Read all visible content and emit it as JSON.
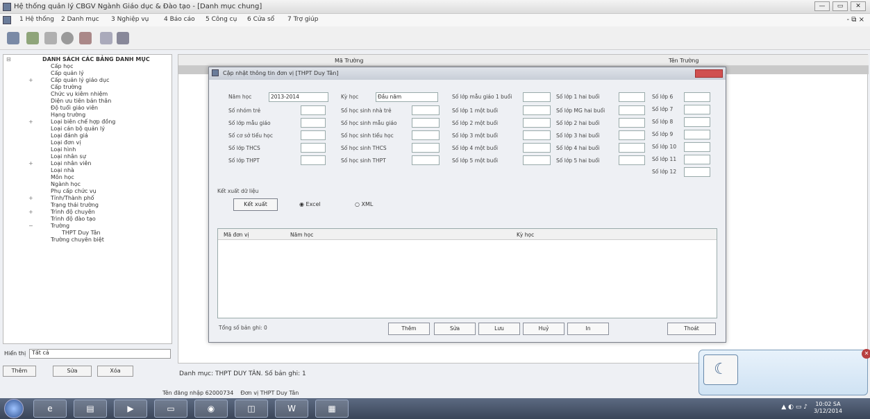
{
  "window": {
    "title": "Hệ thống quản lý CBGV Ngành Giáo dục & Đào tạo - [Danh mục chung]",
    "buttons": [
      "—",
      "▭",
      "✕"
    ]
  },
  "menu": {
    "items": [
      "1 Hệ thống",
      "2 Danh mục",
      "3 Nghiệp vụ",
      "4 Báo cáo",
      "5 Công cụ",
      "6 Cửa sổ",
      "7 Trợ giúp"
    ],
    "mdi_controls": "- ⧉ ×"
  },
  "tree": {
    "root": "DANH SÁCH CÁC BẢNG DANH MỤC",
    "items": [
      "Cấp học",
      "Cấp quản lý",
      "Cấp quản lý giáo dục",
      "Cấp trường",
      "Chức vụ kiêm nhiệm",
      "Diện ưu tiên bản thân",
      "Độ tuổi giáo viên",
      "Hạng trường",
      "Loại biên chế hợp đồng",
      "Loại cán bộ quản lý",
      "Loại đánh giá",
      "Loại đơn vị",
      "Loại hình",
      "Loại nhân sự",
      "Loại nhân viên",
      "Loại nhà",
      "Môn học",
      "Ngành học",
      "Phụ cấp chức vụ",
      "Tỉnh/Thành phố",
      "Trạng thái trường",
      "Trình độ chuyên",
      "Trình độ đào tạo",
      "Trường",
      "THPT Duy Tân",
      "Trường chuyên biệt"
    ]
  },
  "filter": {
    "label": "Hiển thị",
    "value": "Tất cả"
  },
  "left_buttons": [
    "Thêm",
    "Sửa",
    "Xóa"
  ],
  "grid": {
    "col1": "Mã Trường",
    "col2": "Tên Trường"
  },
  "dialog": {
    "title": "Cập nhật thông tin đơn vị [THPT Duy Tân]",
    "fields": {
      "nam_hoc_label": "Năm học",
      "nam_hoc_value": "2013-2014",
      "ky_hoc_label": "Kỳ học",
      "ky_hoc_value": "Đầu năm",
      "col1": [
        "Số nhóm trẻ",
        "Số lớp mẫu giáo",
        "Số cơ sở tiểu học",
        "Số lớp THCS",
        "Số lớp THPT"
      ],
      "col2": [
        "Số học sinh nhà trẻ",
        "Số học sinh mẫu giáo",
        "Số học sinh tiểu học",
        "Số học sinh THCS",
        "Số học sinh THPT"
      ],
      "col3": [
        "Số lớp mẫu giáo 1 buổi",
        "Số lớp 1 một buổi",
        "Số lớp 2 một buổi",
        "Số lớp 3 một buổi",
        "Số lớp 4 một buổi",
        "Số lớp 5 một buổi"
      ],
      "col4": [
        "Số lớp 1 hai buổi",
        "Số lớp MG hai buổi",
        "Số lớp 2 hai buổi",
        "Số lớp 3 hai buổi",
        "Số lớp 4 hai buổi",
        "Số lớp 5 hai buổi"
      ],
      "col5": [
        "Số lớp 6",
        "Số lớp 7",
        "Số lớp 8",
        "Số lớp 9",
        "Số lớp 10",
        "Số lớp 11",
        "Số lớp 12"
      ]
    },
    "export_group_label": "Kết xuất dữ liệu",
    "export_button": "Kết xuất",
    "radio_excel": "Excel",
    "radio_xml": "XML",
    "grid_head": [
      "Mã đơn vị",
      "Năm học",
      "Kỳ học"
    ],
    "footer_text": "Tổng số bản ghi: 0",
    "buttons": [
      "Thêm",
      "Sửa",
      "Lưu",
      "Huỷ",
      "In",
      "Thoát"
    ]
  },
  "status": "Danh mục: THPT DUY TÂN. Số bản ghi: 1",
  "login": {
    "user_label": "Tên đăng nhập",
    "user_value": "62000734",
    "unit_label": "Đơn vị",
    "unit_value": "THPT Duy Tân"
  },
  "clock": {
    "time": "10:02 SA",
    "date": "3/12/2014"
  }
}
